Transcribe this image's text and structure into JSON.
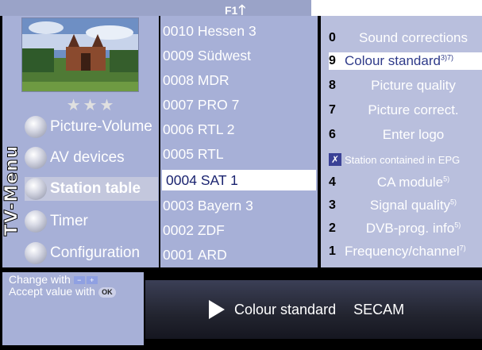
{
  "header": {
    "f1_label": "F1"
  },
  "sidebar": {
    "title": "TV-Menu",
    "rating_stars": "★★★",
    "items": [
      {
        "label": "Picture-Volume"
      },
      {
        "label": "AV devices"
      },
      {
        "label": "Station table"
      },
      {
        "label": "Timer"
      },
      {
        "label": "Configuration"
      }
    ]
  },
  "stations": [
    {
      "number": "0010",
      "name": "Hessen 3"
    },
    {
      "number": "0009",
      "name": "Südwest"
    },
    {
      "number": "0008",
      "name": "MDR"
    },
    {
      "number": "0007",
      "name": "PRO 7"
    },
    {
      "number": "0006",
      "name": "RTL 2"
    },
    {
      "number": "0005",
      "name": "RTL"
    },
    {
      "number": "0004",
      "name": "SAT 1"
    },
    {
      "number": "0003",
      "name": "Bayern 3"
    },
    {
      "number": "0002",
      "name": "ZDF"
    },
    {
      "number": "0001",
      "name": "ARD"
    }
  ],
  "options": [
    {
      "num": "0",
      "label": "Sound corrections",
      "sup": ""
    },
    {
      "num": "9",
      "label": "Colour standard",
      "sup": "3)7)"
    },
    {
      "num": "8",
      "label": "Picture quality",
      "sup": ""
    },
    {
      "num": "7",
      "label": "Picture correct.",
      "sup": ""
    },
    {
      "num": "6",
      "label": "Enter logo",
      "sup": ""
    },
    {
      "num": "✗",
      "label": "Station contained in EPG",
      "sup": ""
    },
    {
      "num": "4",
      "label": "CA module",
      "sup": "5)"
    },
    {
      "num": "3",
      "label": "Signal quality",
      "sup": "5)"
    },
    {
      "num": "2",
      "label": "DVB-prog. info",
      "sup": "5)"
    },
    {
      "num": "1",
      "label": "Frequency/channel",
      "sup": "7)"
    }
  ],
  "help": {
    "change_with": "Change with",
    "accept_with": "Accept value with",
    "minus": "−",
    "plus": "+",
    "ok": "OK"
  },
  "status": {
    "label": "Colour standard",
    "value": "SECAM"
  },
  "colors": {
    "panel": "#a7b0d7",
    "highlight": "#ffffff",
    "text_dark": "#1b2470"
  }
}
